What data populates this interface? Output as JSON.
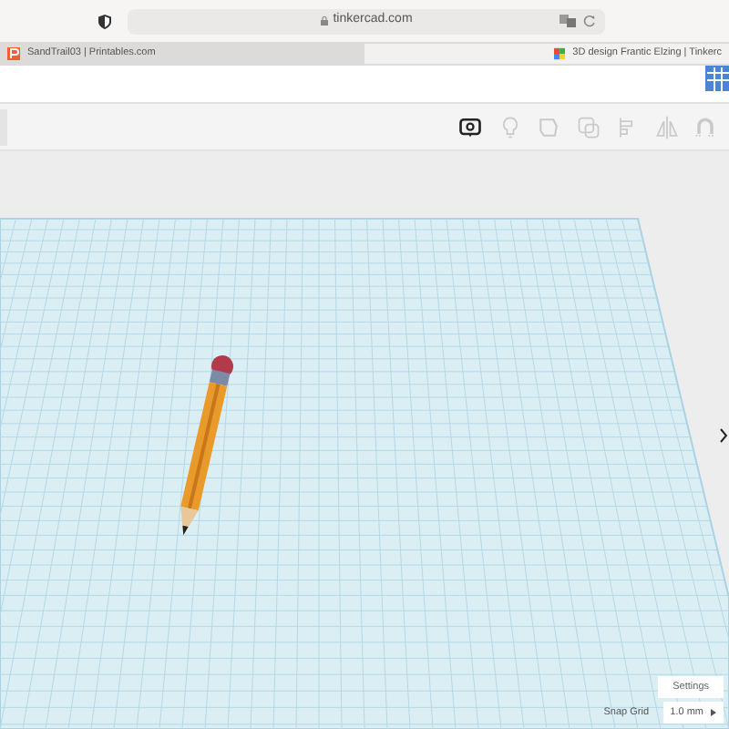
{
  "browser": {
    "address": "tinkercad.com",
    "tabs": [
      {
        "label": "SandTrail03 | Printables.com",
        "selected": false
      },
      {
        "label": "3D design Frantic Elzing | Tinkerc",
        "selected": true
      }
    ]
  },
  "toolbar": {
    "tools": [
      {
        "kind": "note",
        "disabled": false
      },
      {
        "kind": "light",
        "disabled": true
      },
      {
        "kind": "shape",
        "disabled": true
      },
      {
        "kind": "group",
        "disabled": true
      },
      {
        "kind": "align",
        "disabled": true
      },
      {
        "kind": "mirror",
        "disabled": true
      },
      {
        "kind": "magnet",
        "disabled": true
      }
    ]
  },
  "workplane": {
    "settings_button": "Settings",
    "snap_grid_label": "Snap Grid",
    "snap_grid_value": "1.0 mm"
  }
}
